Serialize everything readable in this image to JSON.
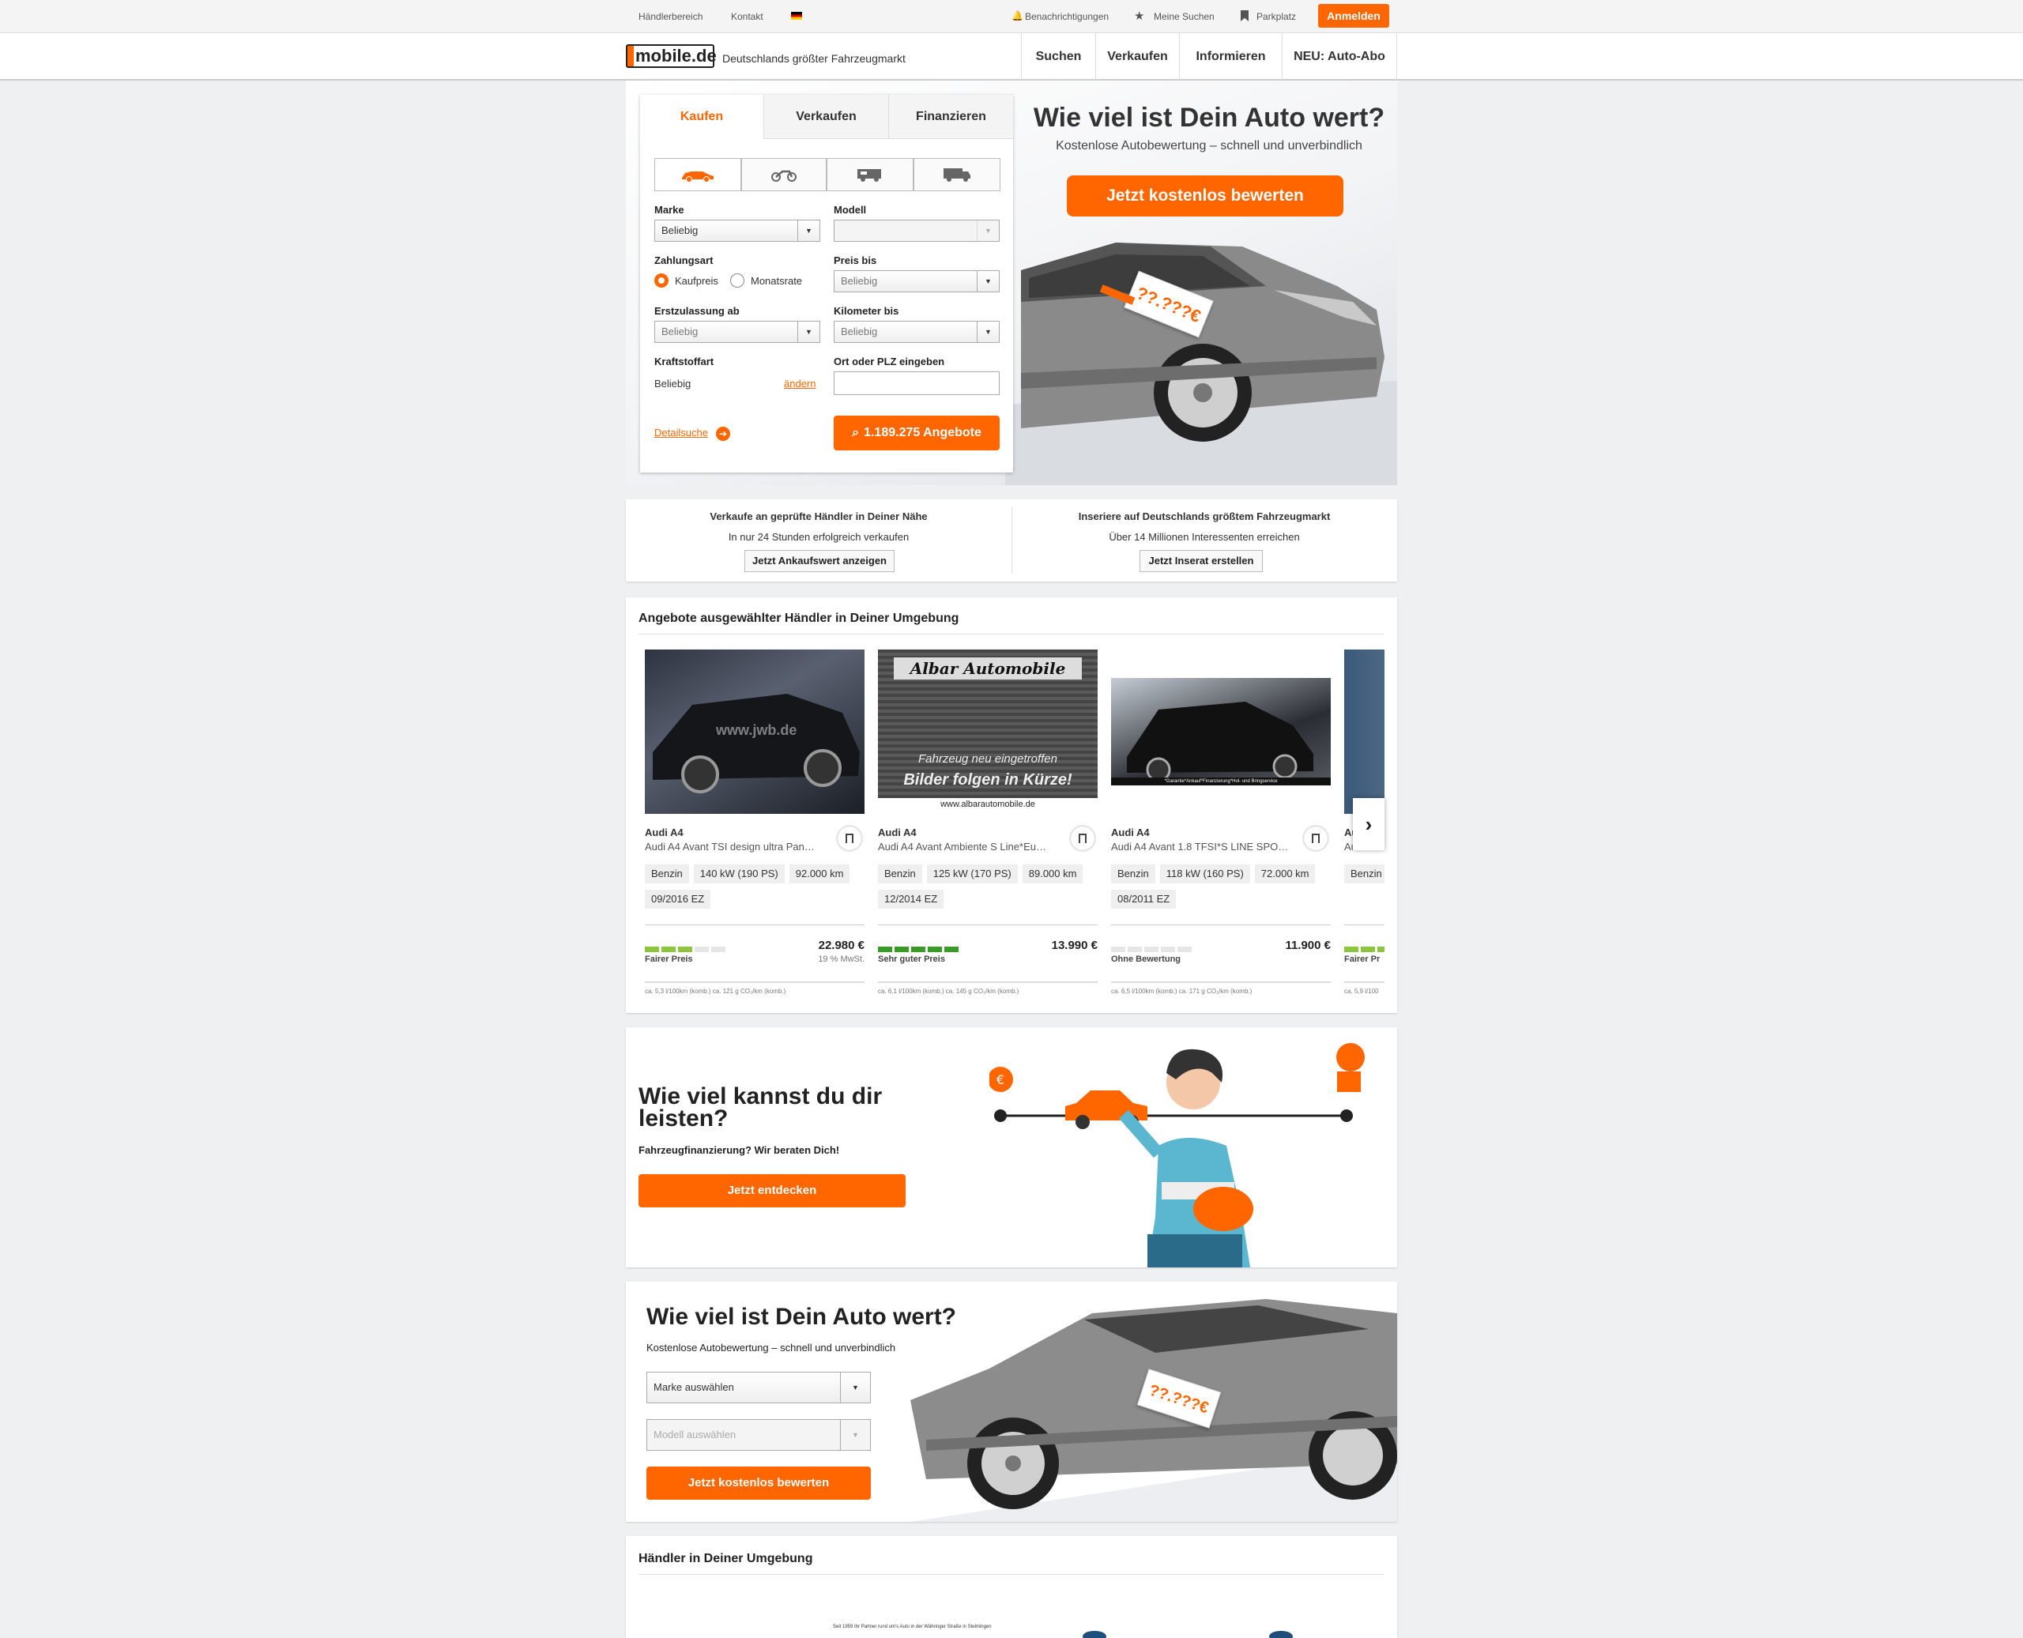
{
  "topbar": {
    "haendler": "Händlerbereich",
    "kontakt": "Kontakt",
    "benachrichtigungen": "Benachrichtigungen",
    "meine_suchen": "Meine Suchen",
    "parkplatz": "Parkplatz",
    "anmelden": "Anmelden"
  },
  "header": {
    "logo": "mobile.de",
    "tagline": "Deutschlands größter Fahrzeugmarkt",
    "nav": [
      "Suchen",
      "Verkaufen",
      "Informieren",
      "NEU: Auto-Abo"
    ]
  },
  "search": {
    "tabs": [
      "Kaufen",
      "Verkaufen",
      "Finanzieren"
    ],
    "vehicle_types": [
      "car-icon",
      "motorbike-icon",
      "camper-icon",
      "truck-icon"
    ],
    "marke_label": "Marke",
    "marke_value": "Beliebig",
    "modell_label": "Modell",
    "zahlungsart_label": "Zahlungsart",
    "kaufpreis": "Kaufpreis",
    "monatsrate": "Monatsrate",
    "preis_label": "Preis bis",
    "preis_value": "Beliebig",
    "ez_label": "Erstzulassung ab",
    "ez_value": "Beliebig",
    "km_label": "Kilometer bis",
    "km_value": "Beliebig",
    "kraftstoff_label": "Kraftstoffart",
    "kraftstoff_value": "Beliebig",
    "aendern": "ändern",
    "ort_label": "Ort oder PLZ eingeben",
    "ort_value": "",
    "detailsuche": "Detailsuche",
    "angebote": "1.189.275 Angebote"
  },
  "hero": {
    "title": "Wie viel ist Dein Auto wert?",
    "subtitle": "Kostenlose Autobewertung – schnell und unverbindlich",
    "cta": "Jetzt kostenlos bewerten",
    "tag": "??.???€"
  },
  "sell": {
    "left_title": "Verkaufe an geprüfte Händler in Deiner Nähe",
    "left_sub": "In nur 24 Stunden erfolgreich verkaufen",
    "left_btn": "Jetzt Ankaufswert anzeigen",
    "right_title": "Inseriere auf Deutschlands größtem Fahrzeugmarkt",
    "right_sub": "Über 14 Millionen Interessenten erreichen",
    "right_btn": "Jetzt Inserat erstellen"
  },
  "offers": {
    "title": "Angebote ausgewählter Händler in Deiner Umgebung",
    "listings": [
      {
        "title": "Audi A4",
        "subtitle": "Audi A4 Avant TSI design ultra Pan…",
        "chips": [
          "Benzin",
          "140 kW (190 PS)",
          "92.000 km",
          "09/2016 EZ"
        ],
        "rating": "Fairer Preis",
        "rating_level": 3,
        "rating_color": "#8cc63f",
        "price": "22.980 €",
        "vat": "19 % MwSt.",
        "emission": "ca. 5,3 l/100km (komb.) ca. 121 g CO₂/km (komb.)",
        "watermark": "www.jwb.de"
      },
      {
        "title": "Audi A4",
        "subtitle": "Audi A4 Avant Ambiente S Line*Eu…",
        "chips": [
          "Benzin",
          "125 kW (170 PS)",
          "89.000 km",
          "12/2014 EZ"
        ],
        "rating": "Sehr guter Preis",
        "rating_level": 5,
        "rating_color": "#3a9a28",
        "price": "13.990 €",
        "vat": "",
        "emission": "ca. 6,1 l/100km (komb.) ca. 145 g CO₂/km (komb.)",
        "sign_title": "Albar Automobile",
        "sign_line1": "Fahrzeug neu eingetroffen",
        "sign_line2": "Bilder folgen in Kürze!",
        "sign_url": "www.albarautomobile.de"
      },
      {
        "title": "Audi A4",
        "subtitle": "Audi A4 Avant 1.8 TFSI*S LINE SPO…",
        "chips": [
          "Benzin",
          "118 kW (160 PS)",
          "72.000 km",
          "08/2011 EZ"
        ],
        "rating": "Ohne Bewertung",
        "rating_level": 0,
        "rating_color": "#e6e6e6",
        "price": "11.900 €",
        "vat": "",
        "emission": "ca. 6,5 l/100km (komb.) ca. 171 g CO₂/km (komb.)",
        "caption": "*Garantie*Ankauf*Finanzierung*Hol- und Bringservice"
      },
      {
        "title": "Au",
        "subtitle": "Au",
        "chips": [
          "Benzin",
          "04/201"
        ],
        "rating": "Fairer Pr",
        "rating_level": 3,
        "rating_color": "#8cc63f",
        "price": "",
        "vat": "",
        "emission": "ca. 5,9 l/100"
      }
    ]
  },
  "finance": {
    "title_line1": "Wie viel kannst du dir",
    "title_line2": "leisten?",
    "subtitle": "Fahrzeugfinanzierung? Wir beraten Dich!",
    "cta": "Jetzt entdecken"
  },
  "value": {
    "title": "Wie viel ist Dein Auto wert?",
    "subtitle": "Kostenlose Autobewertung – schnell und unverbindlich",
    "marke": "Marke auswählen",
    "modell": "Modell auswählen",
    "cta": "Jetzt kostenlos bewerten",
    "tag": "??.???€"
  },
  "dealers": {
    "title": "Händler in Deiner Umgebung",
    "small_text": "Seit 1959 Ihr Partner rund um's Auto in der Währinger Straße in Stelmingen"
  },
  "colors": {
    "accent": "#ff6600",
    "text": "#333333",
    "bg": "#eef0f2"
  }
}
